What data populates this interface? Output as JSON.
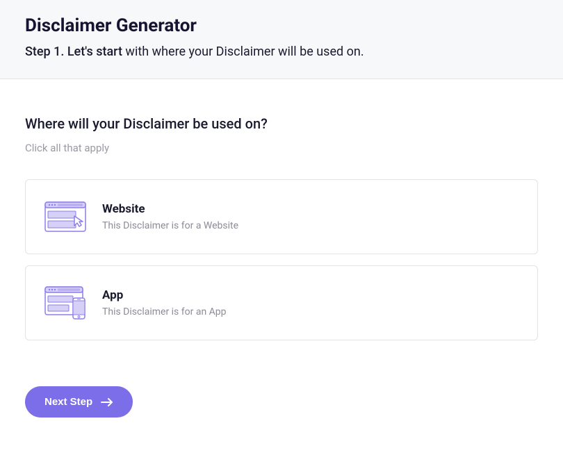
{
  "header": {
    "title": "Disclaimer Generator",
    "step_prefix": "Step 1. Let's start",
    "step_rest": " with where your Disclaimer will be used on."
  },
  "main": {
    "question": "Where will your Disclaimer be used on?",
    "instruction": "Click all that apply",
    "options": [
      {
        "title": "Website",
        "desc": "This Disclaimer is for a Website"
      },
      {
        "title": "App",
        "desc": "This Disclaimer is for an App"
      }
    ],
    "next_button": "Next Step"
  },
  "colors": {
    "accent": "#7c6ee8",
    "icon_stroke": "#8b7de8",
    "icon_fill": "#d6d0f7"
  }
}
